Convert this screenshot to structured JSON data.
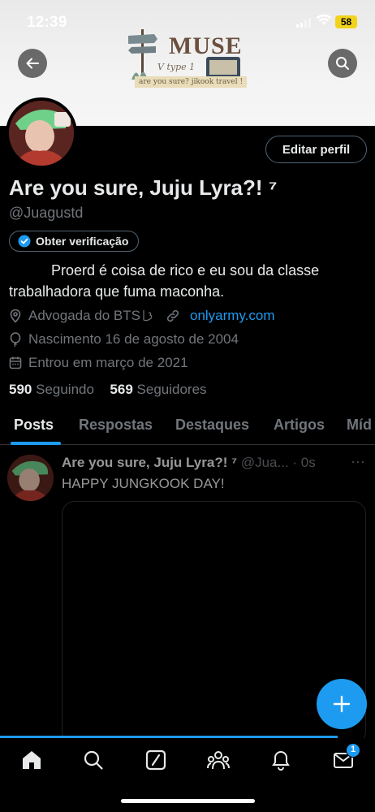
{
  "status_bar": {
    "time": "12:39",
    "battery": "58"
  },
  "banner": {
    "logo_title": "MUSE",
    "logo_subtitle": "V type 1",
    "logo_tagline": "are you sure? jikook travel !"
  },
  "profile": {
    "edit_label": "Editar perfil",
    "name": "Are you sure, Juju Lyra?! ⁷",
    "handle": "@Juagustd",
    "verify_label": "Obter verificação",
    "bio_line1": "Proerd é coisa de rico e eu sou da classe",
    "bio_line2": "trabalhadora que fuma maconha.",
    "location": "Advogada do BTS",
    "website": "onlyarmy.com",
    "birthday": "Nascimento 16 de agosto de 2004",
    "joined": "Entrou em março de 2021",
    "following_count": "590",
    "following_label": "Seguindo",
    "followers_count": "569",
    "followers_label": "Seguidores"
  },
  "tabs": [
    {
      "label": "Posts"
    },
    {
      "label": "Respostas"
    },
    {
      "label": "Destaques"
    },
    {
      "label": "Artigos"
    },
    {
      "label": "Míd"
    }
  ],
  "post": {
    "author": "Are you sure, Juju Lyra?! ⁷",
    "handle_time": " @Jua... · 0s",
    "more": "···",
    "text": "HAPPY JUNGKOOK DAY!"
  },
  "fab_label": "+",
  "nav": {
    "messages_badge": "1"
  },
  "colors": {
    "accent": "#1d9bf0",
    "background": "#000000",
    "muted": "#71767b"
  }
}
